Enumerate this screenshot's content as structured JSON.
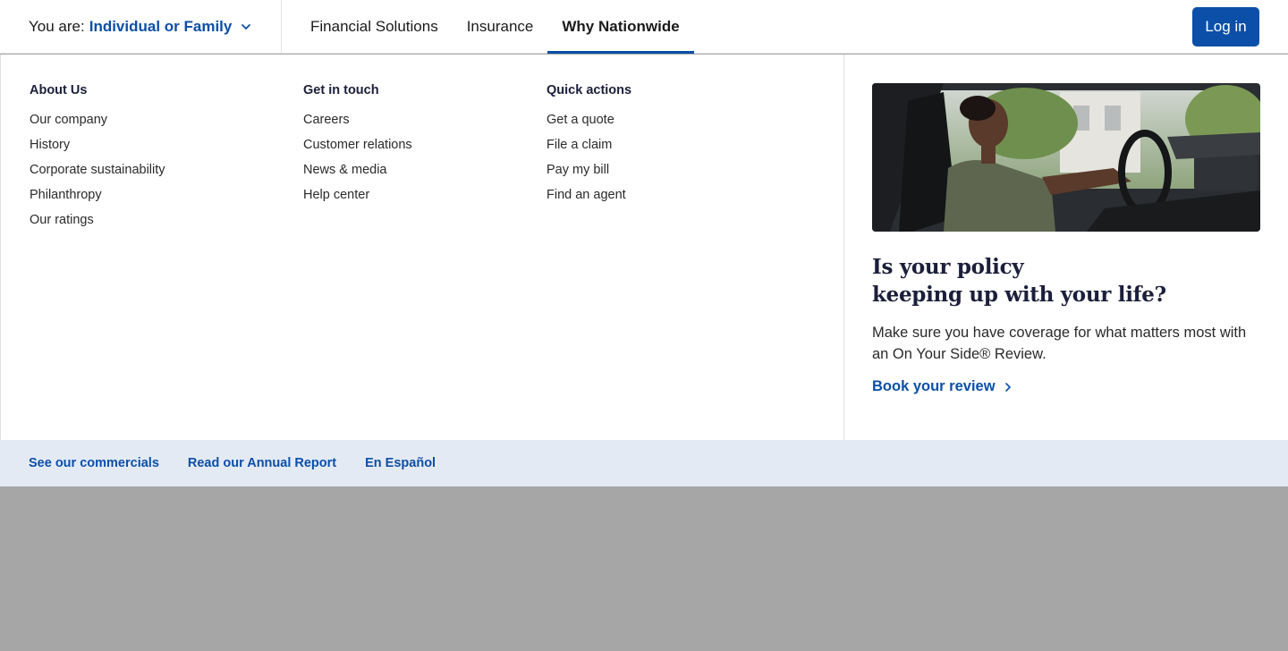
{
  "header": {
    "audience_prefix": "You are:",
    "audience_value": "Individual or Family",
    "nav": [
      "Financial Solutions",
      "Insurance",
      "Why Nationwide"
    ],
    "active_nav": "Why Nationwide",
    "login_label": "Log in",
    "accent_color": "#0b4fa8"
  },
  "menu": {
    "columns": [
      {
        "title": "About Us",
        "items": [
          "Our company",
          "History",
          "Corporate sustainability",
          "Philanthropy",
          "Our ratings"
        ]
      },
      {
        "title": "Get in touch",
        "items": [
          "Careers",
          "Customer relations",
          "News & media",
          "Help center"
        ]
      },
      {
        "title": "Quick actions",
        "items": [
          "Get a quote",
          "File a claim",
          "Pay my bill",
          "Find an agent"
        ]
      }
    ]
  },
  "promo": {
    "image_icon": "woman-driving-car-photo",
    "title_line1": "Is your policy",
    "title_line2": "keeping up with your life?",
    "body": "Make sure you have coverage for what matters most with an On Your Side® Review.",
    "cta_label": "Book your review"
  },
  "footer": {
    "links": [
      "See our commercials",
      "Read our Annual Report",
      "En Español"
    ]
  }
}
